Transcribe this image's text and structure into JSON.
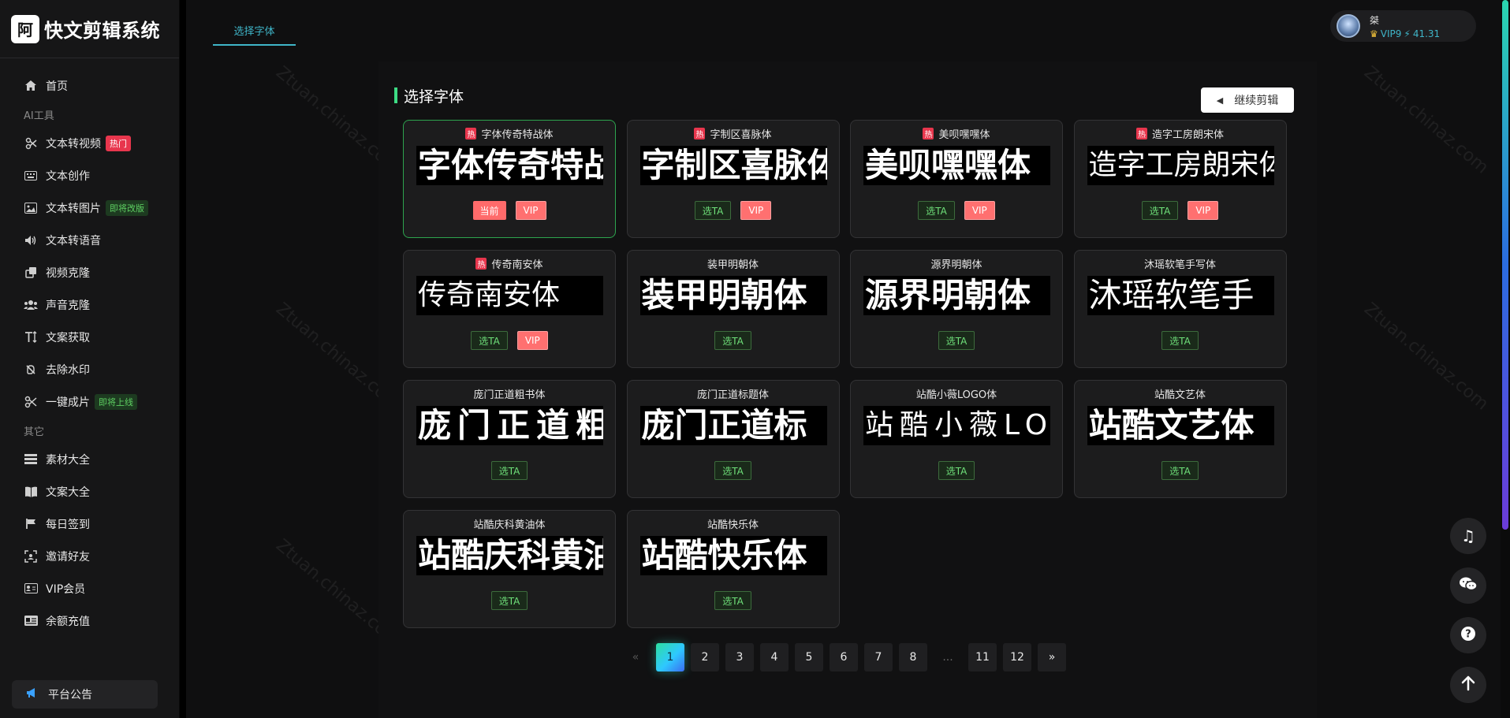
{
  "app": {
    "logo_text": "快文剪辑系统",
    "logo_mark": "阿"
  },
  "nav": {
    "items": [
      {
        "label": "首页",
        "icon": "home-icon"
      },
      {
        "section": "AI工具"
      },
      {
        "label": "文本转视频",
        "icon": "video-icon",
        "tag": "热门",
        "tag_style": "hot"
      },
      {
        "label": "文本创作",
        "icon": "keyboard-icon"
      },
      {
        "label": "文本转图片",
        "icon": "image-icon",
        "tag": "即将改版",
        "tag_style": "green"
      },
      {
        "label": "文本转语音",
        "icon": "speaker-icon"
      },
      {
        "label": "视频克隆",
        "icon": "clone-icon"
      },
      {
        "label": "声音克隆",
        "icon": "users-icon"
      },
      {
        "label": "文案获取",
        "icon": "text-height-icon"
      },
      {
        "label": "去除水印",
        "icon": "eraser-icon"
      },
      {
        "label": "一键成片",
        "icon": "scissors-icon",
        "tag": "即将上线",
        "tag_style": "green"
      },
      {
        "section": "其它"
      },
      {
        "label": "素材大全",
        "icon": "list-icon"
      },
      {
        "label": "文案大全",
        "icon": "book-icon"
      },
      {
        "label": "每日签到",
        "icon": "flag-icon"
      },
      {
        "label": "邀请好友",
        "icon": "qrcode-icon"
      },
      {
        "label": "VIP会员",
        "icon": "vip-card-icon"
      },
      {
        "label": "余额充值",
        "icon": "id-card-icon"
      }
    ],
    "notice": "平台公告"
  },
  "tabs": [
    {
      "label": "选择字体"
    }
  ],
  "user": {
    "name": "桀",
    "vip": "VIP9",
    "balance": "41.31"
  },
  "section_title": "选择字体",
  "continue_label": "继续剪辑",
  "fonts": [
    {
      "name": "字体传奇特战体",
      "hot": true,
      "preview": "字体传奇特战",
      "buttons": [
        "当前",
        "VIP"
      ],
      "selected": true
    },
    {
      "name": "字制区喜脉体",
      "hot": true,
      "preview": "字制区喜脉体",
      "buttons": [
        "选TA",
        "VIP"
      ]
    },
    {
      "name": "美呗嘿嘿体",
      "hot": true,
      "preview": "美呗嘿嘿体",
      "buttons": [
        "选TA",
        "VIP"
      ]
    },
    {
      "name": "造字工房朗宋体",
      "hot": true,
      "preview": "造字工房朗宋体",
      "buttons": [
        "选TA",
        "VIP"
      ]
    },
    {
      "name": "传奇南安体",
      "hot": true,
      "preview": "传奇南安体",
      "buttons": [
        "选TA",
        "VIP"
      ]
    },
    {
      "name": "装甲明朝体",
      "hot": false,
      "preview": "装甲明朝体",
      "buttons": [
        "选TA"
      ]
    },
    {
      "name": "源界明朝体",
      "hot": false,
      "preview": "源界明朝体",
      "buttons": [
        "选TA"
      ]
    },
    {
      "name": "沐瑶软笔手写体",
      "hot": false,
      "preview": "沐瑶软笔手",
      "buttons": [
        "选TA"
      ]
    },
    {
      "name": "庞门正道粗书体",
      "hot": false,
      "preview": "庞门正道粗书",
      "buttons": [
        "选TA"
      ]
    },
    {
      "name": "庞门正道标题体",
      "hot": false,
      "preview": "庞门正道标",
      "buttons": [
        "选TA"
      ]
    },
    {
      "name": "站酷小薇LOGO体",
      "hot": false,
      "preview": "站酷小薇LO",
      "buttons": [
        "选TA"
      ]
    },
    {
      "name": "站酷文艺体",
      "hot": false,
      "preview": "站酷文艺体",
      "buttons": [
        "选TA"
      ]
    },
    {
      "name": "站酷庆科黄油体",
      "hot": false,
      "preview": "站酷庆科黄油",
      "buttons": [
        "选TA"
      ]
    },
    {
      "name": "站酷快乐体",
      "hot": false,
      "preview": "站酷快乐体",
      "buttons": [
        "选TA"
      ]
    }
  ],
  "pagination": {
    "prev": "«",
    "pages": [
      "1",
      "2",
      "3",
      "4",
      "5",
      "6",
      "7",
      "8",
      "...",
      "11",
      "12"
    ],
    "next": "»",
    "current": "1"
  },
  "colors": {
    "accent": "#3fb5c8",
    "hot": "#e8364d",
    "select_green": "#6fe07a",
    "vip": "#ff7070"
  }
}
